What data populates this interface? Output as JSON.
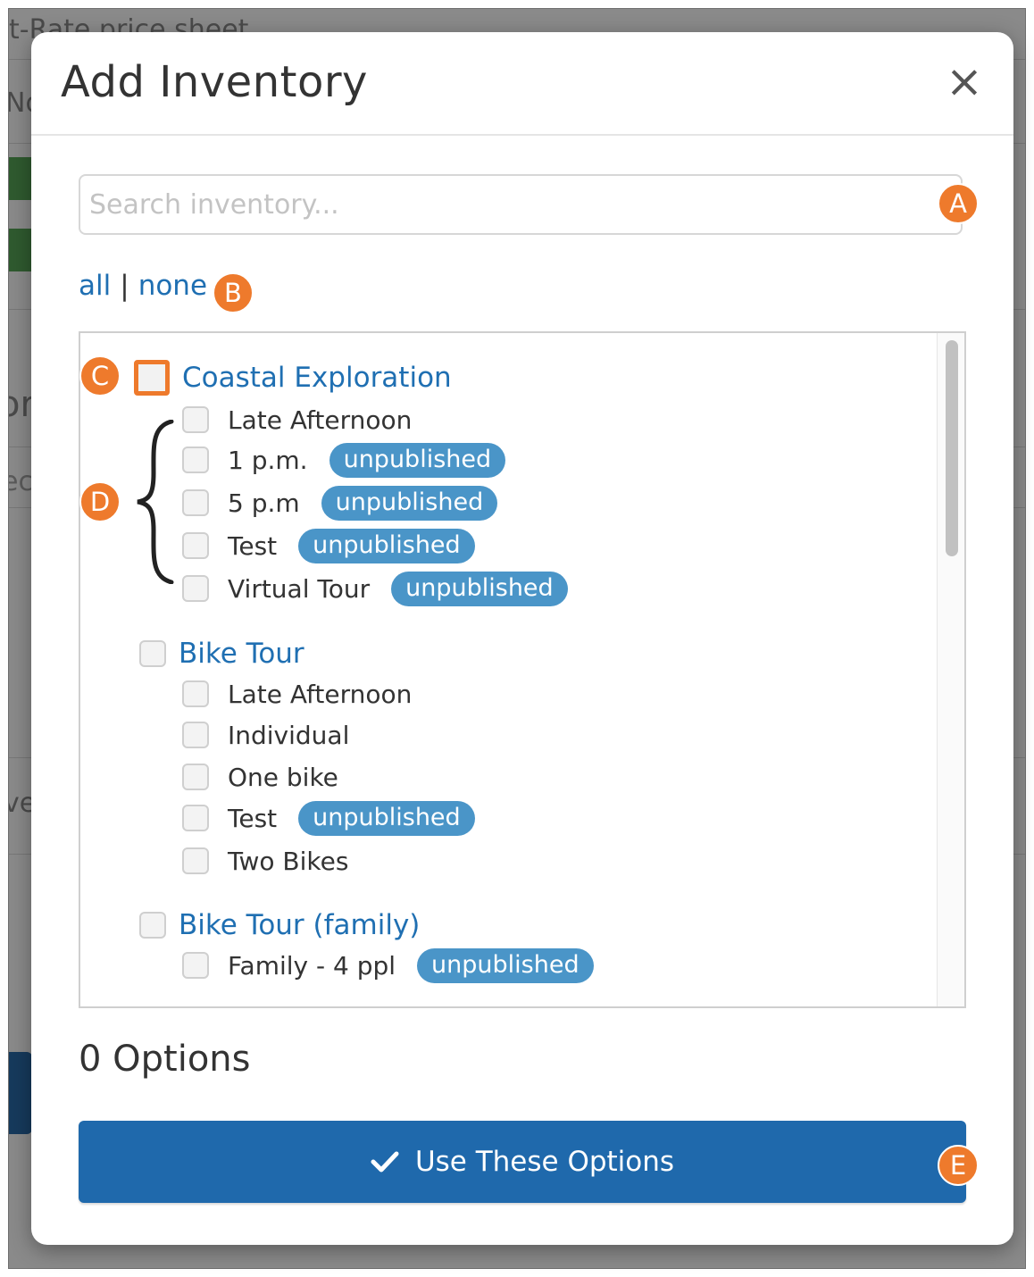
{
  "background_page": {
    "fragments": [
      "t-Rate price sheet",
      "No",
      "or",
      "ec",
      "ve"
    ]
  },
  "modal": {
    "title": "Add Inventory",
    "close_symbol": "×",
    "search": {
      "placeholder": "Search inventory...",
      "value": ""
    },
    "select_all_label": "all",
    "separator": "|",
    "select_none_label": "none",
    "groups": [
      {
        "label": "Coastal Exploration",
        "items": [
          {
            "label": "Late Afternoon",
            "badge": ""
          },
          {
            "label": "1 p.m.",
            "badge": "unpublished"
          },
          {
            "label": "5 p.m",
            "badge": "unpublished"
          },
          {
            "label": "Test",
            "badge": "unpublished"
          },
          {
            "label": "Virtual Tour",
            "badge": "unpublished"
          }
        ]
      },
      {
        "label": "Bike Tour",
        "items": [
          {
            "label": "Late Afternoon",
            "badge": ""
          },
          {
            "label": "Individual",
            "badge": ""
          },
          {
            "label": "One bike",
            "badge": ""
          },
          {
            "label": "Test",
            "badge": "unpublished"
          },
          {
            "label": "Two Bikes",
            "badge": ""
          }
        ]
      },
      {
        "label": "Bike Tour (family)",
        "items": [
          {
            "label": "Family - 4 ppl",
            "badge": "unpublished"
          }
        ]
      }
    ],
    "options_count": "0 Options",
    "submit_label": "Use These Options"
  },
  "annotations": [
    "A",
    "B",
    "C",
    "D",
    "E"
  ],
  "colors": {
    "accent": "#1f69ac",
    "link": "#1f6fb2",
    "badge": "#4a95c8",
    "marker": "#ee7a2c"
  }
}
